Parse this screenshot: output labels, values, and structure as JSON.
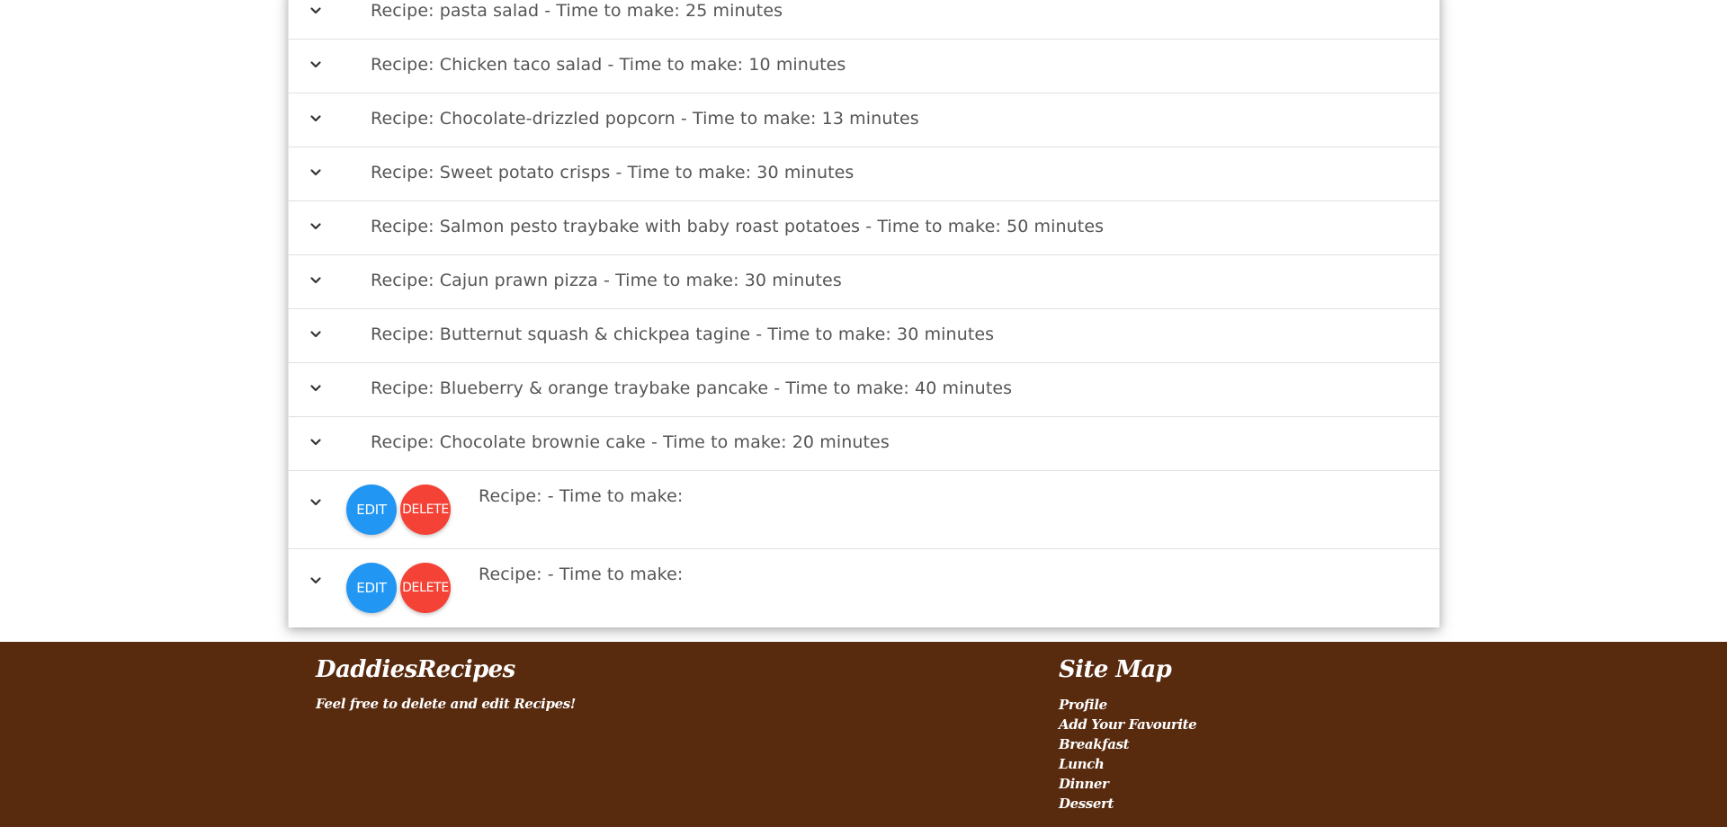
{
  "recipes": [
    {
      "title": "Recipe: pasta salad - Time to make: 25 minutes"
    },
    {
      "title": "Recipe: Chicken taco salad - Time to make: 10 minutes"
    },
    {
      "title": "Recipe: Chocolate-drizzled popcorn - Time to make: 13 minutes"
    },
    {
      "title": "Recipe: Sweet potato crisps - Time to make: 30 minutes"
    },
    {
      "title": "Recipe: Salmon pesto traybake with baby roast potatoes - Time to make: 50 minutes"
    },
    {
      "title": "Recipe: Cajun prawn pizza - Time to make: 30 minutes"
    },
    {
      "title": "Recipe: Butternut squash & chickpea tagine - Time to make: 30 minutes"
    },
    {
      "title": "Recipe: Blueberry & orange traybake pancake - Time to make: 40 minutes"
    },
    {
      "title": "Recipe: Chocolate brownie cake - Time to make: 20 minutes"
    }
  ],
  "editable_recipes": [
    {
      "title": "Recipe: - Time to make:",
      "edit_label": "EDIT",
      "delete_label": "DELETE"
    },
    {
      "title": "Recipe: - Time to make:",
      "edit_label": "EDIT",
      "delete_label": "DELETE"
    }
  ],
  "icons": {
    "row_toggle": "chevron-down-icon"
  },
  "colors": {
    "edit_button": "#2196f3",
    "delete_button": "#f44336",
    "footer_background": "#582a0e",
    "footer_text": "#ffffff",
    "recipe_text": "#555555"
  },
  "footer": {
    "brand": "DaddiesRecipes",
    "tagline": "Feel free to delete and edit Recipes!",
    "sitemap_title": "Site Map",
    "links": [
      "Profile",
      "Add Your Favourite",
      "Breakfast",
      "Lunch",
      "Dinner",
      "Dessert"
    ]
  }
}
